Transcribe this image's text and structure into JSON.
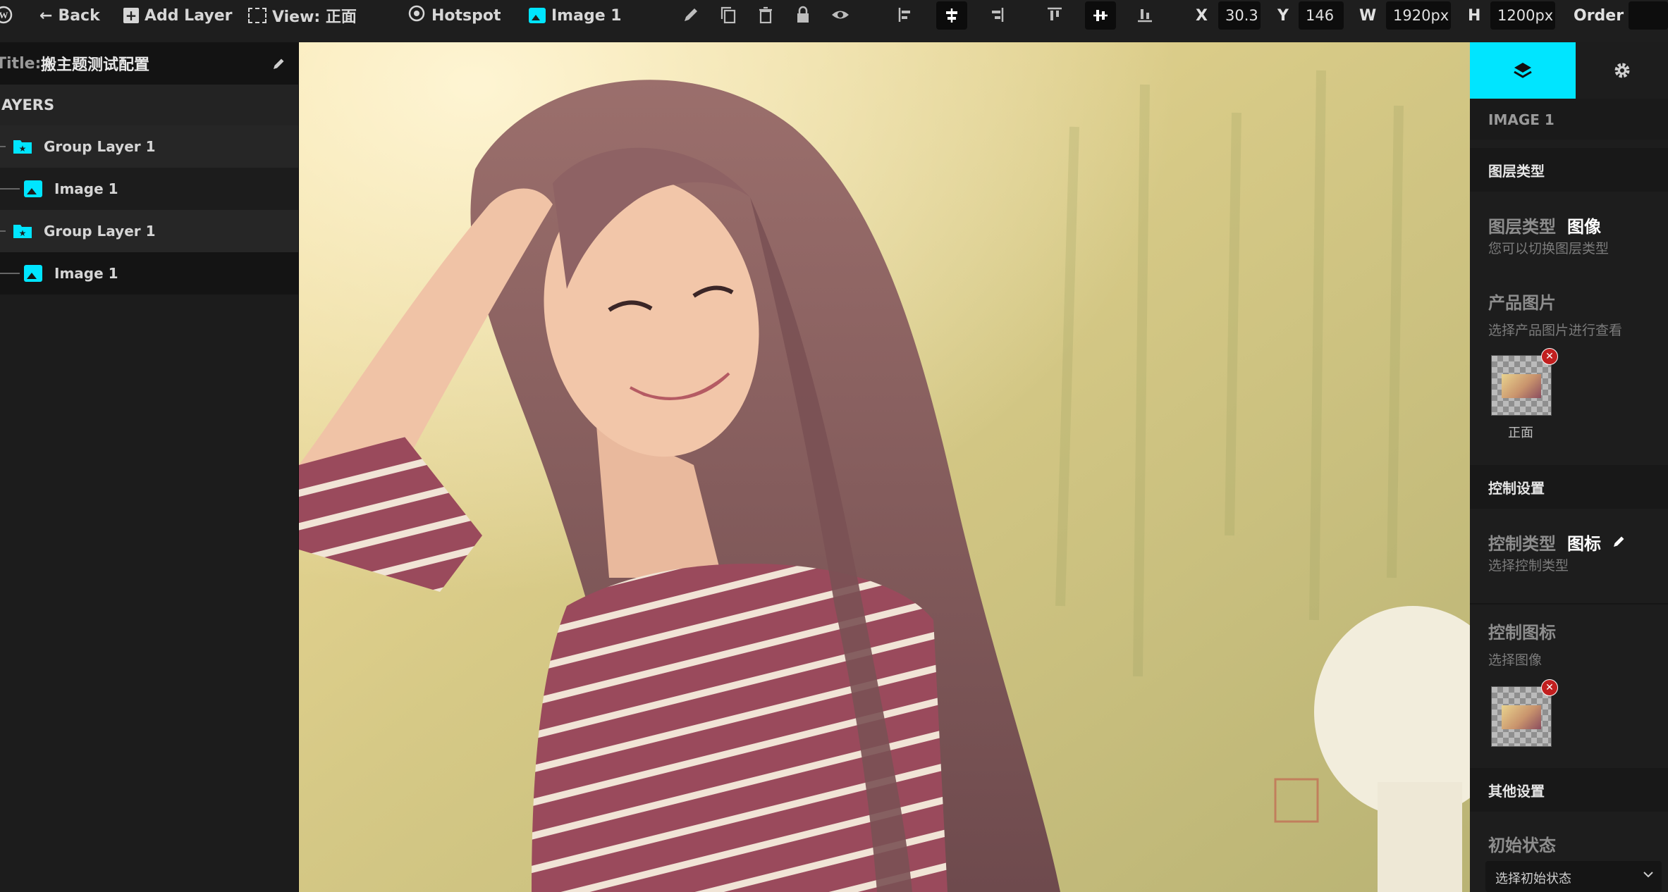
{
  "toolbar": {
    "back_label": "Back",
    "add_layer_label": "Add Layer",
    "view_label": "View: 正面",
    "hotspot_label": "Hotspot",
    "current_layer_label": "Image 1",
    "x_label": "X",
    "x_value": "30.3",
    "y_label": "Y",
    "y_value": "146",
    "w_label": "W",
    "w_value": "1920px",
    "h_label": "H",
    "h_value": "1200px",
    "order_label": "Order"
  },
  "left_panel": {
    "title_prefix": "Title:",
    "title_value": "搬主题测试配置",
    "layers_heading": "AYERS",
    "layers": [
      {
        "label": "Group Layer 1",
        "type": "group"
      },
      {
        "label": "Image 1",
        "type": "image"
      },
      {
        "label": "Group Layer 1",
        "type": "group"
      },
      {
        "label": "Image 1",
        "type": "image"
      }
    ]
  },
  "right_panel": {
    "layer_name": "IMAGE 1",
    "section_layer_type": "图层类型",
    "layer_type_label": "图层类型",
    "layer_type_value": "图像",
    "layer_type_hint": "您可以切换图层类型",
    "product_image_label": "产品图片",
    "product_image_hint": "选择产品图片进行查看",
    "product_image_caption": "正面",
    "section_control": "控制设置",
    "control_type_label": "控制类型",
    "control_type_value": "图标",
    "control_type_hint": "选择控制类型",
    "control_icon_label": "控制图标",
    "control_icon_hint": "选择图像",
    "section_other": "其他设置",
    "initial_state_label": "初始状态",
    "initial_state_placeholder": "选择初始状态"
  },
  "colors": {
    "accent": "#00e5ff",
    "remove_badge": "#c21f1f"
  }
}
